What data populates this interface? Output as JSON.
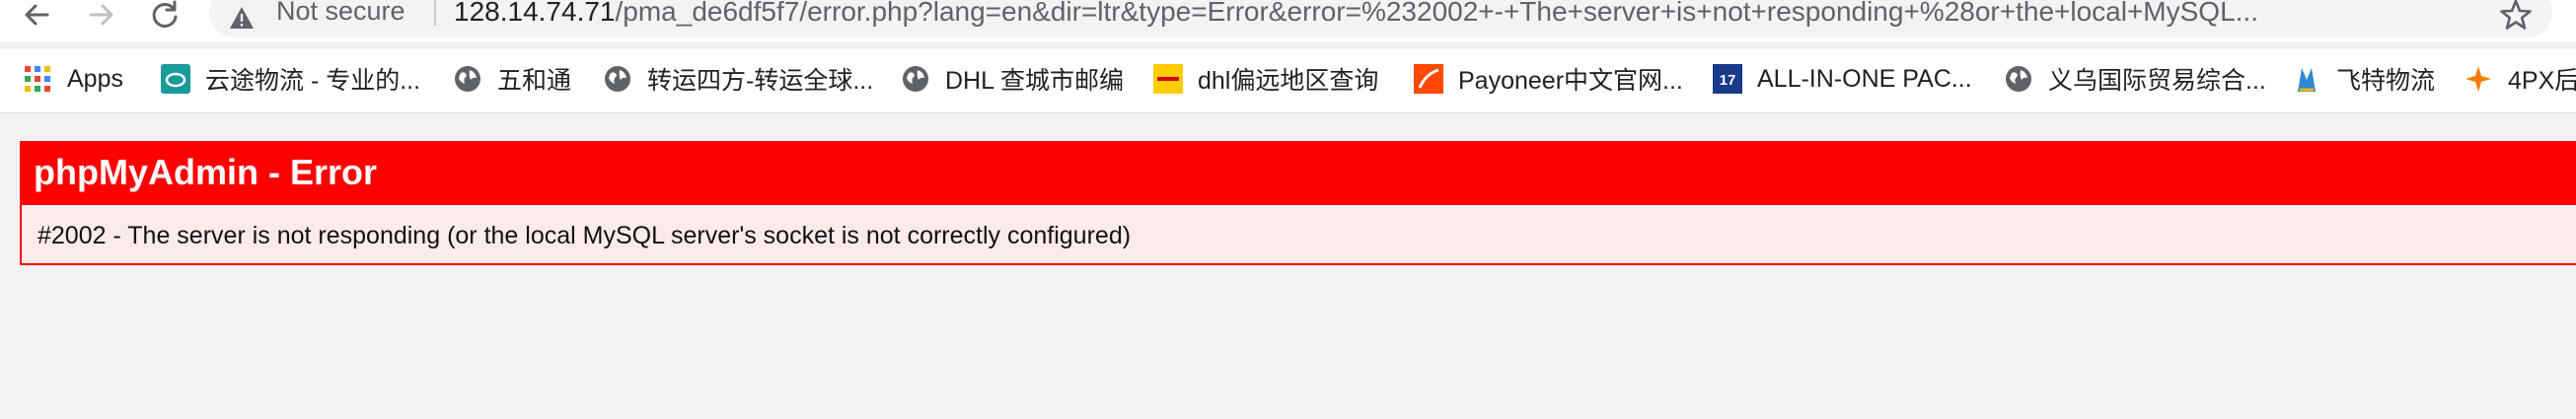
{
  "browser": {
    "security_label": "Not secure",
    "url_host": "128.14.74.71",
    "url_path": "/pma_de6df5f7/error.php?lang=en&dir=ltr&type=Error&error=%232002+-+The+server+is+not+responding+%28or+the+local+MySQL..."
  },
  "bookmarks": [
    {
      "label": "Apps",
      "icon": "apps-grid-icon"
    },
    {
      "label": "云途物流 - 专业的...",
      "icon": "yuntu-logo-icon"
    },
    {
      "label": "五和通",
      "icon": "globe-icon"
    },
    {
      "label": "转运四方-转运全球...",
      "icon": "globe-icon"
    },
    {
      "label": "DHL 查城市邮编",
      "icon": "globe-icon"
    },
    {
      "label": "dhl偏远地区查询",
      "icon": "dhl-logo-icon"
    },
    {
      "label": "Payoneer中文官网...",
      "icon": "payoneer-logo-icon"
    },
    {
      "label": "ALL-IN-ONE PAC...",
      "icon": "17track-logo-icon"
    },
    {
      "label": "义乌国际贸易综合...",
      "icon": "globe-icon"
    },
    {
      "label": "飞特物流",
      "icon": "feite-logo-icon"
    },
    {
      "label": "4PX后",
      "icon": "4px-logo-icon"
    }
  ],
  "error": {
    "title": "phpMyAdmin - Error",
    "message": "#2002 - The server is not responding (or the local MySQL server's socket is not correctly configured)"
  },
  "colors": {
    "error_header": "#ff0000",
    "error_body": "#fdeaea"
  }
}
